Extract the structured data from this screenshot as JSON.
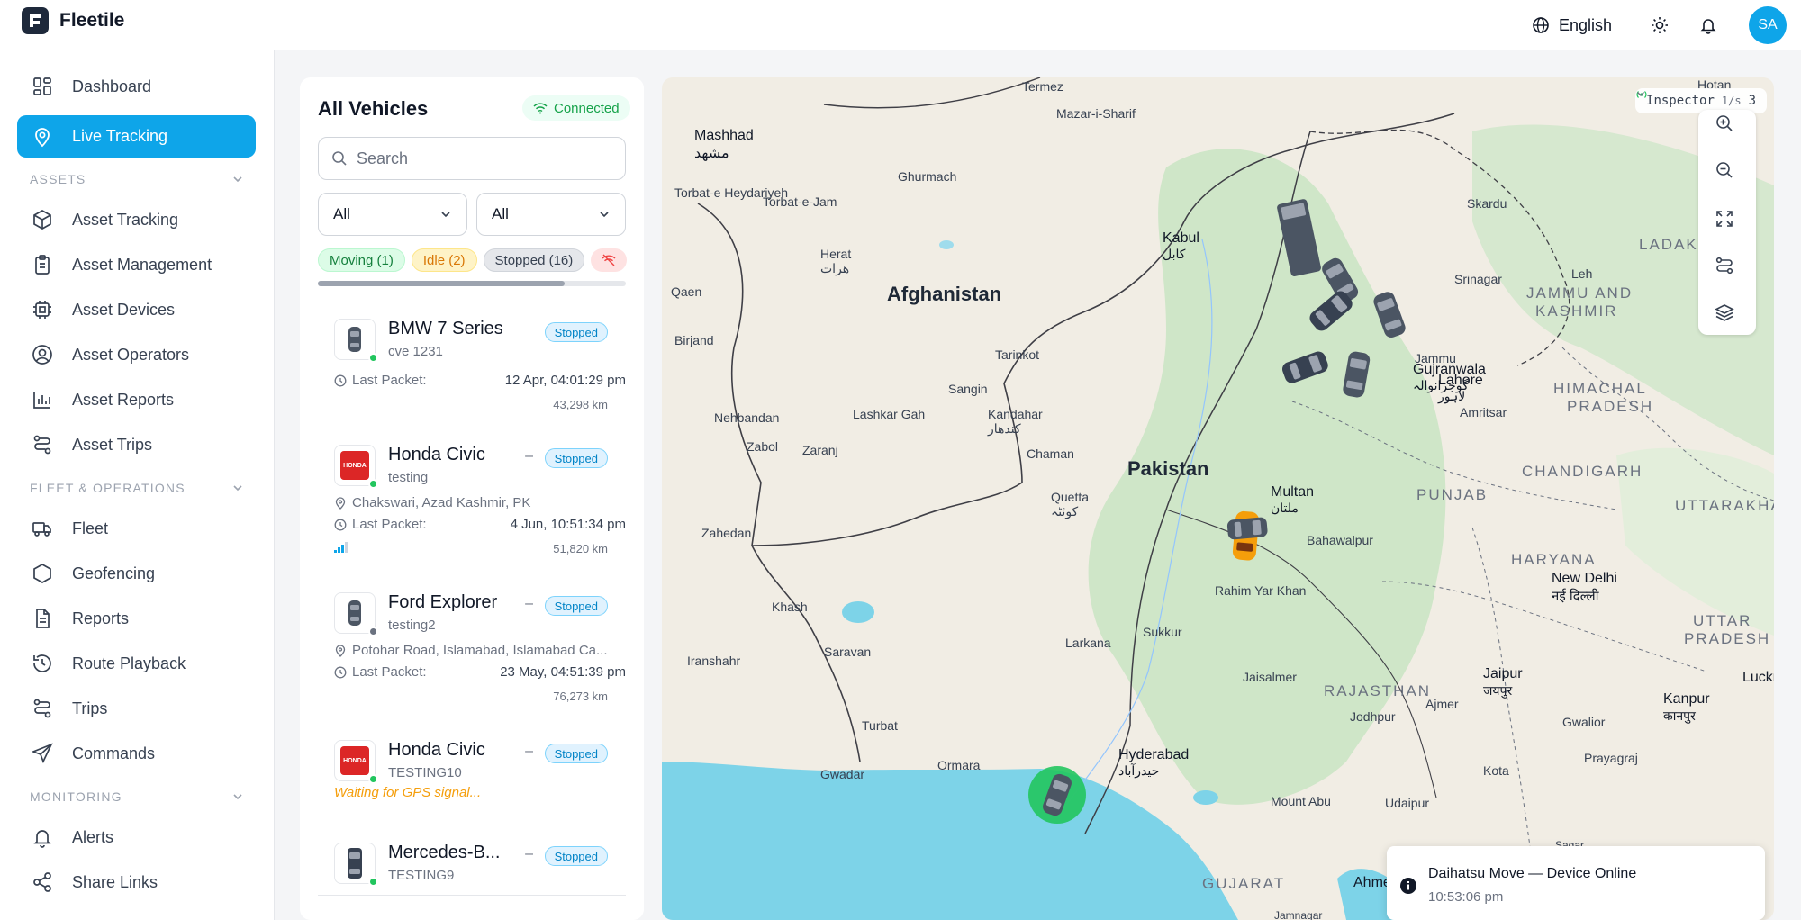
{
  "app": {
    "name": "Fleetile"
  },
  "topbar": {
    "language": "English",
    "avatar_initials": "SA"
  },
  "sidebar": {
    "items_top": [
      {
        "label": "Dashboard",
        "icon": "dashboard-icon"
      },
      {
        "label": "Live Tracking",
        "icon": "location-pin-icon",
        "active": true
      }
    ],
    "sections": [
      {
        "title": "ASSETS",
        "items": [
          "Asset Tracking",
          "Asset Management",
          "Asset Devices",
          "Asset Operators",
          "Asset Reports",
          "Asset Trips"
        ]
      },
      {
        "title": "FLEET & OPERATIONS",
        "items": [
          "Fleet",
          "Geofencing",
          "Reports",
          "Route Playback",
          "Trips",
          "Commands"
        ]
      },
      {
        "title": "MONITORING",
        "items": [
          "Alerts",
          "Share Links"
        ]
      }
    ]
  },
  "panel": {
    "title": "All Vehicles",
    "connection": "Connected",
    "search_placeholder": "Search",
    "filter1": "All",
    "filter2": "All",
    "chips": {
      "moving": "Moving (1)",
      "idle": "Idle (2)",
      "stopped": "Stopped (16)"
    },
    "vehicles": [
      {
        "name": "BMW 7 Series",
        "plate": "cve 1231",
        "status": "Stopped",
        "last_packet_label": "Last Packet:",
        "last_packet": "12 Apr, 04:01:29 pm",
        "odometer": "43,298 km",
        "online": true
      },
      {
        "name": "Honda Civic",
        "plate": "testing",
        "status": "Stopped",
        "dash": "–",
        "address": "Chakswari, Azad Kashmir, PK",
        "last_packet_label": "Last Packet:",
        "last_packet": "4 Jun, 10:51:34 pm",
        "odometer": "51,820 km",
        "online": true
      },
      {
        "name": "Ford Explorer",
        "plate": "testing2",
        "status": "Stopped",
        "dash": "–",
        "address": "Potohar Road, Islamabad, Islamabad Ca...",
        "last_packet_label": "Last Packet:",
        "last_packet": "23 May, 04:51:39 pm",
        "odometer": "76,273 km",
        "online": false
      },
      {
        "name": "Honda Civic",
        "plate": "TESTING10",
        "status": "Stopped",
        "dash": "–",
        "note": "Waiting for GPS signal...",
        "online": true
      },
      {
        "name": "Mercedes-B...",
        "plate": "TESTING9",
        "status": "Stopped",
        "dash": "–",
        "online": true
      }
    ]
  },
  "map": {
    "inspector": "Inspector",
    "inspector_rate": "1/s",
    "inspector_count": "3",
    "countries": [
      "Afghanistan",
      "Pakistan"
    ],
    "regions": [
      "LADAKH",
      "JAMMU AND",
      "KASHMIR",
      "HIMACHAL",
      "PRADESH",
      "PUNJAB",
      "CHANDIGARH",
      "UTTARAKHAND",
      "HARYANA",
      "UTTAR",
      "PRADESH",
      "RAJASTHAN",
      "GUJARAT"
    ],
    "cities": [
      {
        "name": "Mashhad",
        "local": "مشهد"
      },
      {
        "name": "Kabul",
        "local": "کابل"
      },
      {
        "name": "Herat",
        "local": "هرات"
      },
      {
        "name": "Kandahar",
        "local": "کندهار"
      },
      {
        "name": "Quetta",
        "local": "کوئٹہ"
      },
      {
        "name": "Multan",
        "local": "ملتان"
      },
      {
        "name": "Lahore",
        "local": "لاہور"
      },
      {
        "name": "Gujranwala",
        "local": "گوجرانوالہ"
      },
      {
        "name": "Hyderabad",
        "local": "حیدرآباد"
      },
      {
        "name": "New Delhi",
        "local": "नई दिल्ली"
      },
      {
        "name": "Jaipur",
        "local": "जयपुर"
      },
      {
        "name": "Kanpur",
        "local": "कानपुर"
      }
    ],
    "small_places": [
      "Termez",
      "Mazar-i-Sharif",
      "Ghurmach",
      "Torbat-e Heydariyeh",
      "Torbat-e-Jam",
      "Qaen",
      "Birjand",
      "Nehbandan",
      "Zabol",
      "Zaranj",
      "Lashkar Gah",
      "Tarinkot",
      "Sangin",
      "Chaman",
      "Zahedan",
      "Khash",
      "Saravan",
      "Iranshahr",
      "Turbat",
      "Gwadar",
      "Ormara",
      "Larkana",
      "Sukkur",
      "Rahim Yar Khan",
      "Bahawalpur",
      "Jaisalmer",
      "Jodhpur",
      "Ajmer",
      "Udaipur",
      "Mount Abu",
      "Kota",
      "Gwalior",
      "Prayagraj",
      "Srinagar",
      "Leh",
      "Skardu",
      "Jammu",
      "Amritsar",
      "Hotan",
      "Ahmedabad",
      "Jamnagar",
      "Sagar",
      "Luckn"
    ]
  },
  "toast": {
    "title": "Daihatsu Move — Device Online",
    "time": "10:53:06 pm"
  },
  "colors": {
    "accent": "#0ea5e9",
    "moving": "#16a34a",
    "idle": "#f59e0b",
    "stopped": "#0284c7",
    "water": "#7dd3e8",
    "land": "#f1ede4",
    "green": "#c7e6c5"
  }
}
